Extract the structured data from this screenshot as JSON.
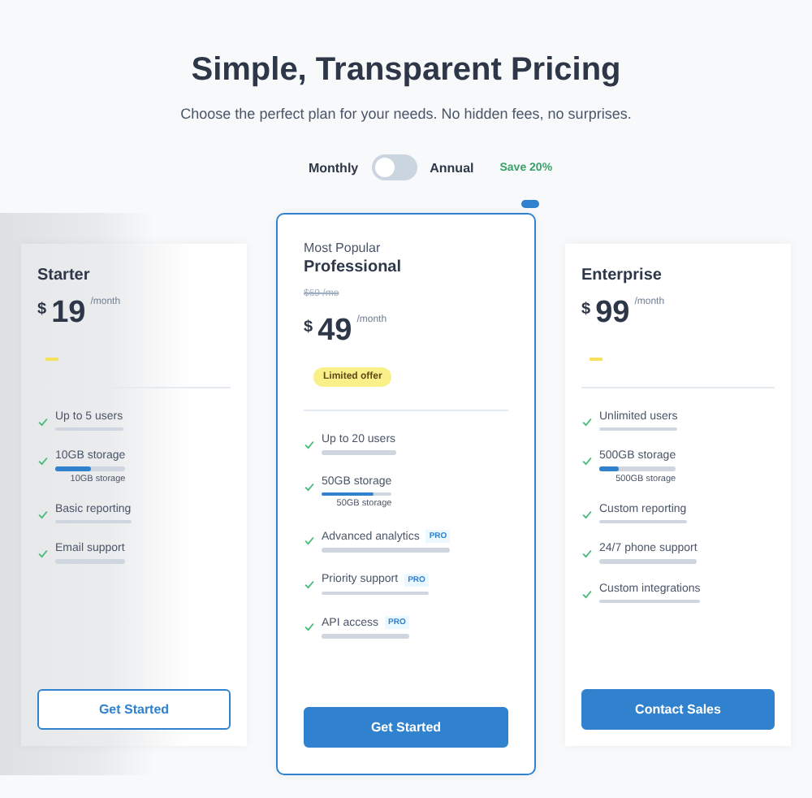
{
  "header": {
    "title": "Simple, Transparent Pricing",
    "subtitle": "Choose the perfect plan for your needs. No hidden fees, no surprises."
  },
  "billing": {
    "left_label": "Monthly",
    "toggle_on": false,
    "right_label": "Annual",
    "save_note": "Save 20%"
  },
  "plans": [
    {
      "name": "Starter",
      "featured": false,
      "currency": "$",
      "price": "19",
      "period": "/month",
      "promo_mark": true,
      "features": [
        {
          "kind": "plain",
          "text": "Up to 5 users"
        },
        {
          "kind": "meter",
          "text": "10GB storage",
          "level": 0.5,
          "caption": "10GB storage"
        },
        {
          "kind": "plain",
          "text": "Basic reporting"
        },
        {
          "kind": "plain",
          "text": "Email support"
        }
      ],
      "button": {
        "label": "Get Started",
        "kind": "outline"
      }
    },
    {
      "name": "Professional",
      "featured": true,
      "tagline": "Most Popular",
      "old_price": "$69 /mo",
      "currency": "$",
      "price": "49",
      "period": "/month",
      "badge": "Limited offer",
      "features": [
        {
          "kind": "plain",
          "text": "Up to 20 users"
        },
        {
          "kind": "meter",
          "text": "50GB storage",
          "level": 0.75,
          "caption": "50GB storage"
        },
        {
          "kind": "plain",
          "text": "Advanced analytics",
          "tag": "PRO"
        },
        {
          "kind": "plain",
          "text": "Priority support",
          "tag": "PRO"
        },
        {
          "kind": "plain",
          "text": "API access",
          "tag": "PRO"
        }
      ],
      "button": {
        "label": "Get Started",
        "kind": "solid"
      }
    },
    {
      "name": "Enterprise",
      "featured": false,
      "currency": "$",
      "price": "99",
      "period": "/month",
      "promo_mark": true,
      "features": [
        {
          "kind": "plain",
          "text": "Unlimited users"
        },
        {
          "kind": "meter",
          "text": "500GB storage",
          "level": 0.25,
          "caption": "500GB storage"
        },
        {
          "kind": "plain",
          "text": "Custom reporting"
        },
        {
          "kind": "plain",
          "text": "24/7 phone support"
        },
        {
          "kind": "plain",
          "text": "Custom integrations"
        }
      ],
      "button": {
        "label": "Contact Sales",
        "kind": "solid"
      }
    }
  ]
}
